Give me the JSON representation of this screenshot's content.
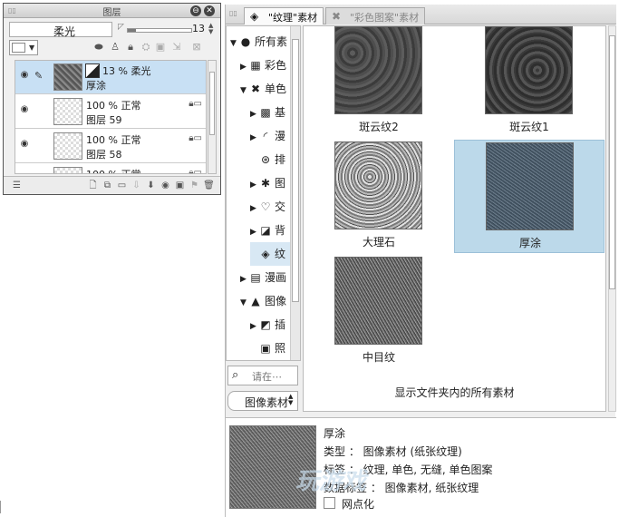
{
  "layer_panel": {
    "title": "图层",
    "blend_mode": "柔光",
    "opacity": "13",
    "opacity_fraction": 0.13,
    "layers": [
      {
        "line1": "13 % 柔光",
        "line2": "厚涂",
        "selected": true,
        "textured": true,
        "has_mask": true
      },
      {
        "line1": "100 % 正常",
        "line2": "图层 59",
        "selected": false,
        "textured": false,
        "has_mask": false
      },
      {
        "line1": "100 % 正常",
        "line2": "图层 58",
        "selected": false,
        "textured": false,
        "has_mask": false
      },
      {
        "line1": "100 % 正常",
        "line2": "",
        "selected": false,
        "textured": false,
        "has_mask": false
      }
    ]
  },
  "material_panel": {
    "tabs": [
      {
        "label": "\"纹理\"素材",
        "active": true
      },
      {
        "label": "\"彩色图案\"素材",
        "active": false
      }
    ],
    "tree": [
      {
        "label": "所有素",
        "level": 0,
        "twisty": "▼",
        "icon": "●"
      },
      {
        "label": "彩色",
        "level": 1,
        "twisty": "▶",
        "icon": "▦"
      },
      {
        "label": "单色",
        "level": 1,
        "twisty": "▼",
        "icon": "✖"
      },
      {
        "label": "基",
        "level": 2,
        "twisty": "▶",
        "icon": "▩"
      },
      {
        "label": "漫",
        "level": 2,
        "twisty": "▶",
        "icon": "◜"
      },
      {
        "label": "排",
        "level": 2,
        "twisty": "",
        "icon": "⊛"
      },
      {
        "label": "图",
        "level": 2,
        "twisty": "▶",
        "icon": "✱"
      },
      {
        "label": "交",
        "level": 2,
        "twisty": "▶",
        "icon": "♡"
      },
      {
        "label": "背",
        "level": 2,
        "twisty": "▶",
        "icon": "◪"
      },
      {
        "label": "纹",
        "level": 2,
        "twisty": "",
        "icon": "◈",
        "selected": true
      },
      {
        "label": "漫画",
        "level": 1,
        "twisty": "▶",
        "icon": "▤"
      },
      {
        "label": "图像",
        "level": 1,
        "twisty": "▼",
        "icon": "▲"
      },
      {
        "label": "插",
        "level": 2,
        "twisty": "▶",
        "icon": "◩"
      },
      {
        "label": "照",
        "level": 2,
        "twisty": "",
        "icon": "▣"
      }
    ],
    "search_placeholder": "请在⋯",
    "tag_filter": "图像素材",
    "materials": [
      {
        "name": "斑云纹2",
        "selected": false,
        "texture": "tx1"
      },
      {
        "name": "斑云纹1",
        "selected": false,
        "texture": "tx2"
      },
      {
        "name": "大理石",
        "selected": false,
        "texture": "tx3"
      },
      {
        "name": "厚涂",
        "selected": true,
        "texture": "tx4"
      },
      {
        "name": "中目纹",
        "selected": false,
        "texture": "tx5"
      }
    ],
    "show_all_label": "显示文件夹内的所有素材"
  },
  "detail": {
    "name": "厚涂",
    "type_line": "类型 ： 图像素材 (纸张纹理)",
    "tags_line": "标签 ： 纹理, 单色, 无缝, 单色图案",
    "data_tags_line": "数据标签 ： 图像素材, 纸张纹理",
    "halftone_label": "网点化"
  },
  "watermark": "玩游戏"
}
